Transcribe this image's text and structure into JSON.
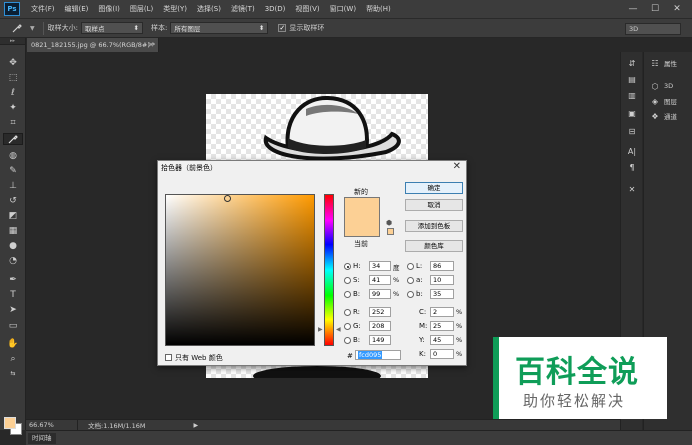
{
  "app": {
    "logo": "Ps"
  },
  "menu": [
    "文件(F)",
    "编辑(E)",
    "图像(I)",
    "图层(L)",
    "类型(Y)",
    "选择(S)",
    "滤镜(T)",
    "3D(D)",
    "视图(V)",
    "窗口(W)",
    "帮助(H)"
  ],
  "window_controls": {
    "minimize": "—",
    "maximize": "☐",
    "close": "✕"
  },
  "options_bar": {
    "sample_size_label": "取样大小:",
    "sample_size_value": "取样点",
    "sample_label": "样本:",
    "sample_value": "所有图层",
    "show_ring_label": "显示取样环",
    "workspace_value": "3D"
  },
  "document": {
    "tab_title": "0821_182155.jpg @ 66.7%(RGB/8#) *"
  },
  "color_picker": {
    "title": "拾色器（前景色）",
    "new_label": "新的",
    "current_label": "当前",
    "buttons": {
      "ok": "确定",
      "cancel": "取消",
      "add_to_swatches": "添加到色板",
      "color_libraries": "颜色库"
    },
    "new_color": "#fcd095",
    "current_color": "#fcd095",
    "fields": {
      "H": {
        "label": "H:",
        "value": "34",
        "unit": "度"
      },
      "S": {
        "label": "S:",
        "value": "41",
        "unit": "%"
      },
      "Bv": {
        "label": "B:",
        "value": "99",
        "unit": "%"
      },
      "R": {
        "label": "R:",
        "value": "252"
      },
      "G": {
        "label": "G:",
        "value": "208"
      },
      "Bc": {
        "label": "B:",
        "value": "149"
      },
      "L": {
        "label": "L:",
        "value": "86"
      },
      "a": {
        "label": "a:",
        "value": "10"
      },
      "b": {
        "label": "b:",
        "value": "35"
      },
      "C": {
        "label": "C:",
        "value": "2",
        "unit": "%"
      },
      "M": {
        "label": "M:",
        "value": "25",
        "unit": "%"
      },
      "Y": {
        "label": "Y:",
        "value": "45",
        "unit": "%"
      },
      "K": {
        "label": "K:",
        "value": "0",
        "unit": "%"
      }
    },
    "hex_label": "#",
    "hex_value": "fcd095",
    "web_only_label": "只有 Web 颜色",
    "hue_base_color": "#ff9a00"
  },
  "right_panel": {
    "items": [
      {
        "icon": "sliders-icon",
        "label": "属性"
      },
      {
        "icon": "cube-icon",
        "label": "3D"
      },
      {
        "icon": "layers-icon",
        "label": "图层"
      },
      {
        "icon": "channels-icon",
        "label": "通道"
      }
    ]
  },
  "status": {
    "zoom": "66.67%",
    "doc_info": "文档:1.16M/1.16M",
    "arrow": "▶"
  },
  "timeline": {
    "label": "时间轴"
  },
  "colors": {
    "foreground": "#fcd095",
    "background": "#ffffff"
  },
  "watermark": {
    "title": "百科全说",
    "subtitle": "助你轻松解决"
  }
}
